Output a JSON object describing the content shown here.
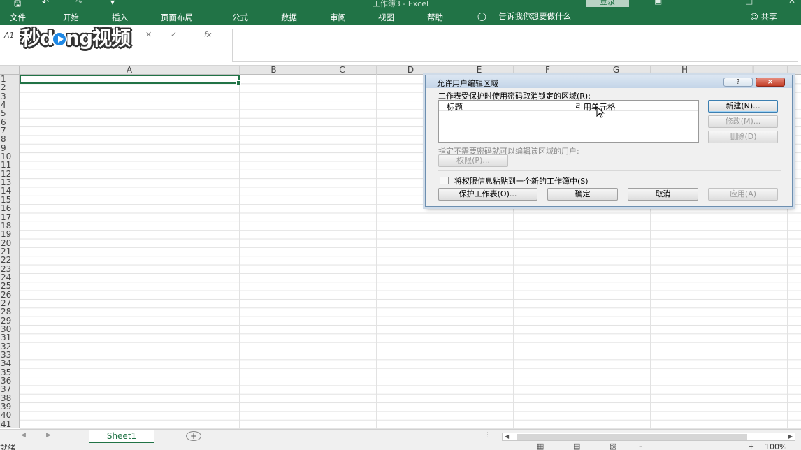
{
  "titlebar": {
    "title": "工作簿3  -  Excel",
    "save_icon": "save-icon",
    "undo_icon": "undo-icon",
    "redo_icon": "redo-icon",
    "signin": "登录"
  },
  "menu": {
    "items": [
      "文件",
      "开始",
      "插入",
      "页面布局",
      "公式",
      "数据",
      "审阅",
      "视图",
      "帮助"
    ],
    "tell_me": "告诉我你想要做什么",
    "share": "共享"
  },
  "formula_bar": {
    "name_box": "A1",
    "fx": "fx"
  },
  "watermark": {
    "part1": "秒d",
    "part2": "ng视频"
  },
  "grid": {
    "columns": [
      "A",
      "B",
      "C",
      "D",
      "E",
      "F",
      "G",
      "H",
      "I"
    ],
    "rows": [
      "1",
      "2",
      "3",
      "4",
      "5",
      "6",
      "7",
      "8",
      "9",
      "10",
      "11",
      "12",
      "13",
      "14",
      "15",
      "16",
      "17",
      "18",
      "19",
      "20",
      "21",
      "22",
      "23",
      "24",
      "25",
      "26",
      "27",
      "28",
      "29",
      "30",
      "31",
      "32",
      "33",
      "34",
      "35",
      "36",
      "37",
      "38",
      "39",
      "40",
      "41"
    ]
  },
  "sheet_tabs": {
    "active": "Sheet1",
    "add": "+"
  },
  "statusbar": {
    "ready": "就绪",
    "zoom": "100%"
  },
  "dialog": {
    "title": "允许用户编辑区域",
    "help": "?",
    "close": "×",
    "ranges_label": "工作表受保护时使用密码取消锁定的区域(R):",
    "col_title": "标题",
    "col_ref": "引用单元格",
    "btn_new": "新建(N)...",
    "btn_modify": "修改(M)...",
    "btn_delete": "删除(D)",
    "users_label": "指定不需要密码就可以编辑该区域的用户:",
    "btn_permissions": "权限(P)...",
    "paste_check_label": "将权限信息粘贴到一个新的工作簿中(S)",
    "btn_protect": "保护工作表(O)...",
    "btn_ok": "确定",
    "btn_cancel": "取消",
    "btn_apply": "应用(A)"
  }
}
